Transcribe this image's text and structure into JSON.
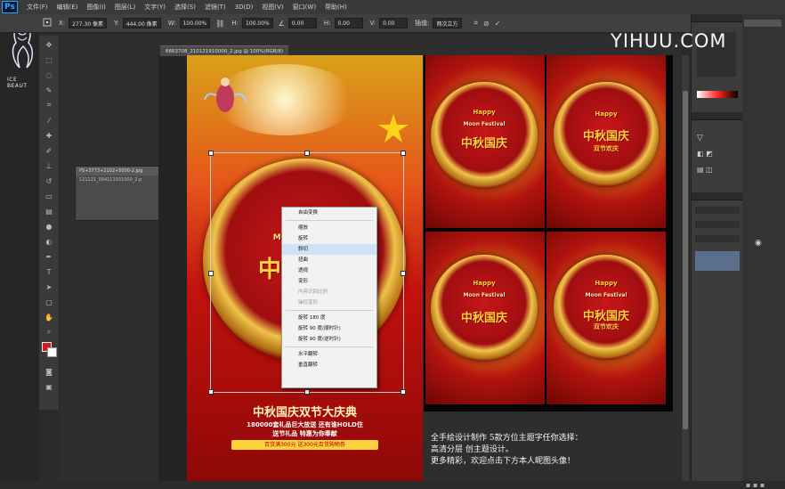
{
  "app": {
    "name": "Ps"
  },
  "menubar": {
    "items": [
      "文件(F)",
      "编辑(E)",
      "图像(I)",
      "图层(L)",
      "文字(Y)",
      "选择(S)",
      "滤镜(T)",
      "3D(D)",
      "视图(V)",
      "窗口(W)",
      "帮助(H)"
    ]
  },
  "options": {
    "x_value": "277.30 像素",
    "y_value": "444.00 像素",
    "w_value": "100.00%",
    "h_value": "100.00%",
    "angle_value": "0.00",
    "h_skew_value": "0.00",
    "v_skew_value": "0.00",
    "interp_label": "插值:",
    "interp_value": "两次立方"
  },
  "watermark": "YIHUU.COM",
  "logo_text": "ICE BEAUT",
  "document": {
    "tab_title": "6663708_210121910000_2.jpg @ 100%(RGB/8)"
  },
  "floating_window": {
    "rows": [
      "PS+3773+2102+5000-2.jpg",
      "121121_094111931000_2.p"
    ]
  },
  "poster": {
    "title": "中秋国庆双节大庆典",
    "line1": "180000套礼品巨大放送 还有谁HOLD住",
    "line2": "送节礼品 特惠为你奉献",
    "bar": "百货满300元 送300元百货购物券"
  },
  "context_menu": {
    "items": [
      {
        "label": "自由变换",
        "disabled": false
      },
      {
        "sep": true
      },
      {
        "label": "缩放",
        "disabled": false
      },
      {
        "label": "旋转",
        "disabled": false
      },
      {
        "label": "斜切",
        "disabled": false,
        "highlight": true
      },
      {
        "label": "扭曲",
        "disabled": false
      },
      {
        "label": "透视",
        "disabled": false
      },
      {
        "label": "变形",
        "disabled": false
      },
      {
        "label": "内容识别比例",
        "disabled": true
      },
      {
        "label": "操控变形",
        "disabled": true
      },
      {
        "sep": true
      },
      {
        "label": "旋转 180 度",
        "disabled": false
      },
      {
        "label": "旋转 90 度(顺时针)",
        "disabled": false
      },
      {
        "label": "旋转 90 度(逆时针)",
        "disabled": false
      },
      {
        "sep": true
      },
      {
        "label": "水平翻转",
        "disabled": false
      },
      {
        "label": "垂直翻转",
        "disabled": false
      }
    ]
  },
  "thumb_text": {
    "happy": "Happy",
    "festival": "Moon Festival",
    "main": "中秋国庆",
    "sub": "双节欢庆"
  },
  "bottom_text": [
    "全手绘设计制作   5款方位主题字任你选择：",
    "高清分层  创主题设计。",
    "更多精彩，欢迎点击下方本人昵图头像！"
  ],
  "colors": {
    "accent": "#31a8ff",
    "poster_red": "#c2120e",
    "gold": "#ffd23e"
  },
  "icons": [
    "move-icon",
    "marquee-icon",
    "lasso-icon",
    "quick-select-icon",
    "crop-icon",
    "eyedropper-icon",
    "healing-icon",
    "brush-icon",
    "stamp-icon",
    "history-brush-icon",
    "eraser-icon",
    "gradient-icon",
    "blur-icon",
    "dodge-icon",
    "pen-icon",
    "type-icon",
    "path-select-icon",
    "shape-icon",
    "hand-icon",
    "zoom-icon"
  ]
}
